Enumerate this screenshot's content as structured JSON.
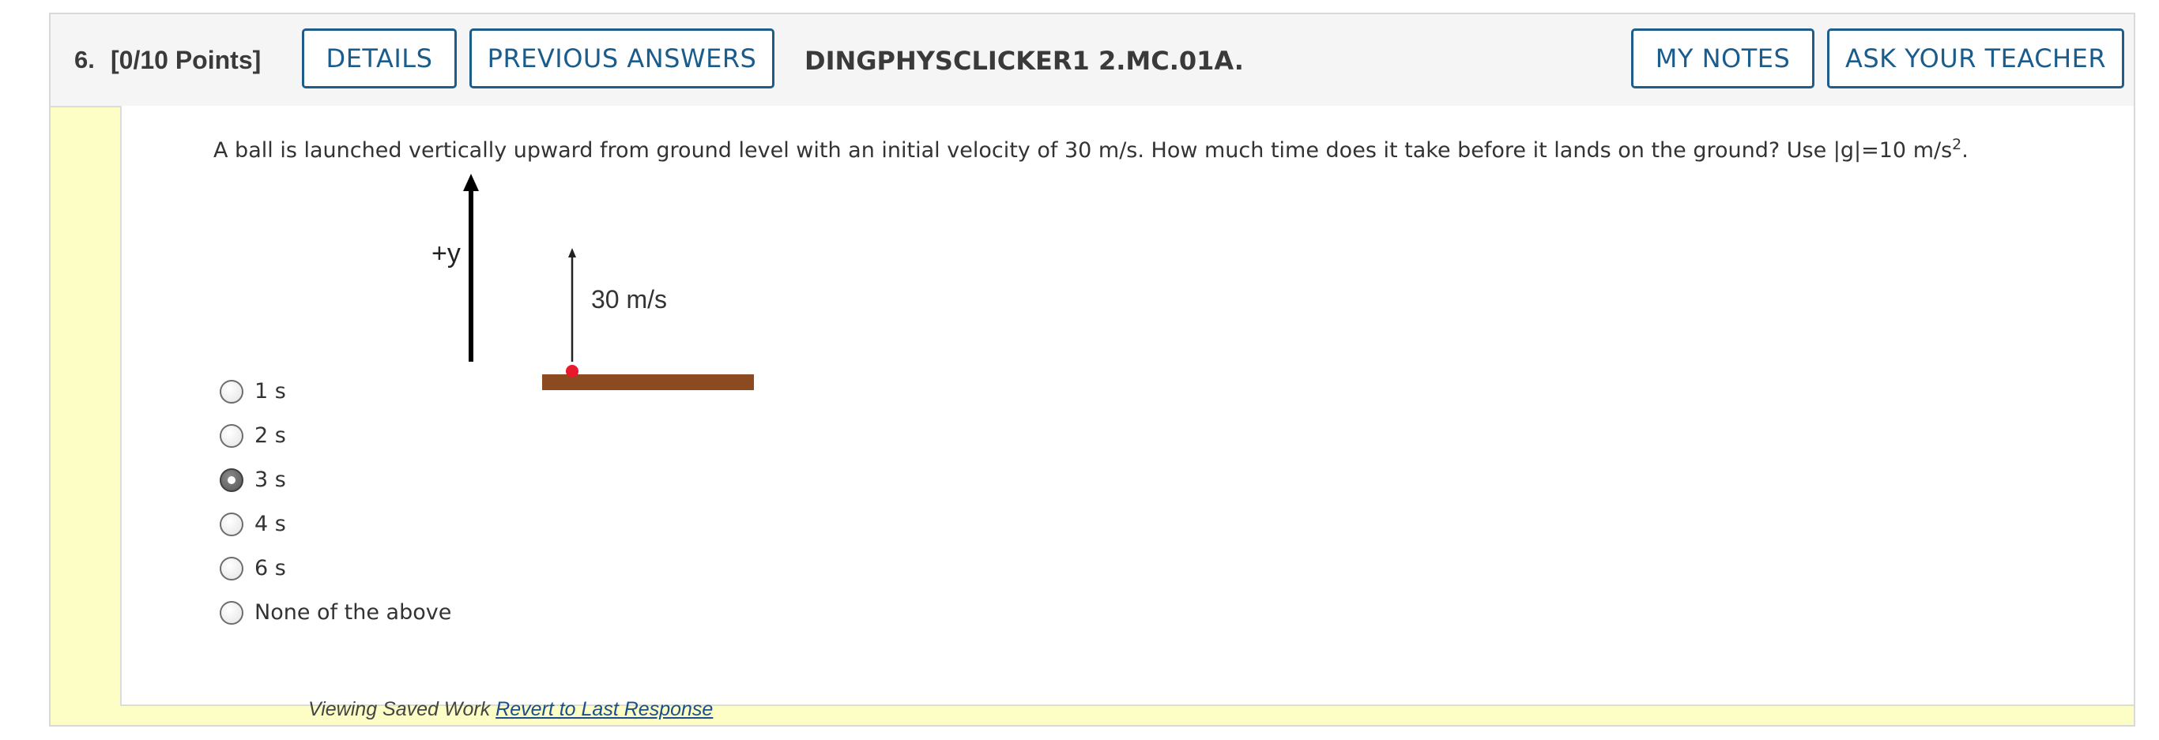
{
  "header": {
    "question_number": "6.",
    "points": "[0/10 Points]",
    "details_label": "DETAILS",
    "previous_answers_label": "PREVIOUS ANSWERS",
    "assignment_code": "DINGPHYSCLICKER1 2.MC.01A.",
    "my_notes_label": "MY NOTES",
    "ask_teacher_label": "ASK YOUR TEACHER"
  },
  "question": {
    "text_before_exponent": "A ball is launched vertically upward from ground level with an initial velocity of 30 m/s. How much time does it take before it lands on the ground? Use |g|=10 m/s",
    "exponent": "2",
    "text_after_exponent": "."
  },
  "figure": {
    "axis_label": "+y",
    "velocity_label": "30 m/s",
    "ground_color": "#8b4a1f",
    "ball_color": "#e8192c"
  },
  "choices": [
    {
      "label": "1 s",
      "selected": false
    },
    {
      "label": "2 s",
      "selected": false
    },
    {
      "label": "3 s",
      "selected": true
    },
    {
      "label": "4 s",
      "selected": false
    },
    {
      "label": "6 s",
      "selected": false
    },
    {
      "label": "None of the above",
      "selected": false
    }
  ],
  "footer": {
    "status_text": "Viewing Saved Work",
    "revert_link": "Revert to Last Response"
  },
  "colors": {
    "accent": "#1a5c8c",
    "card_background": "#fdfdc6",
    "header_background": "#f5f5f5"
  }
}
